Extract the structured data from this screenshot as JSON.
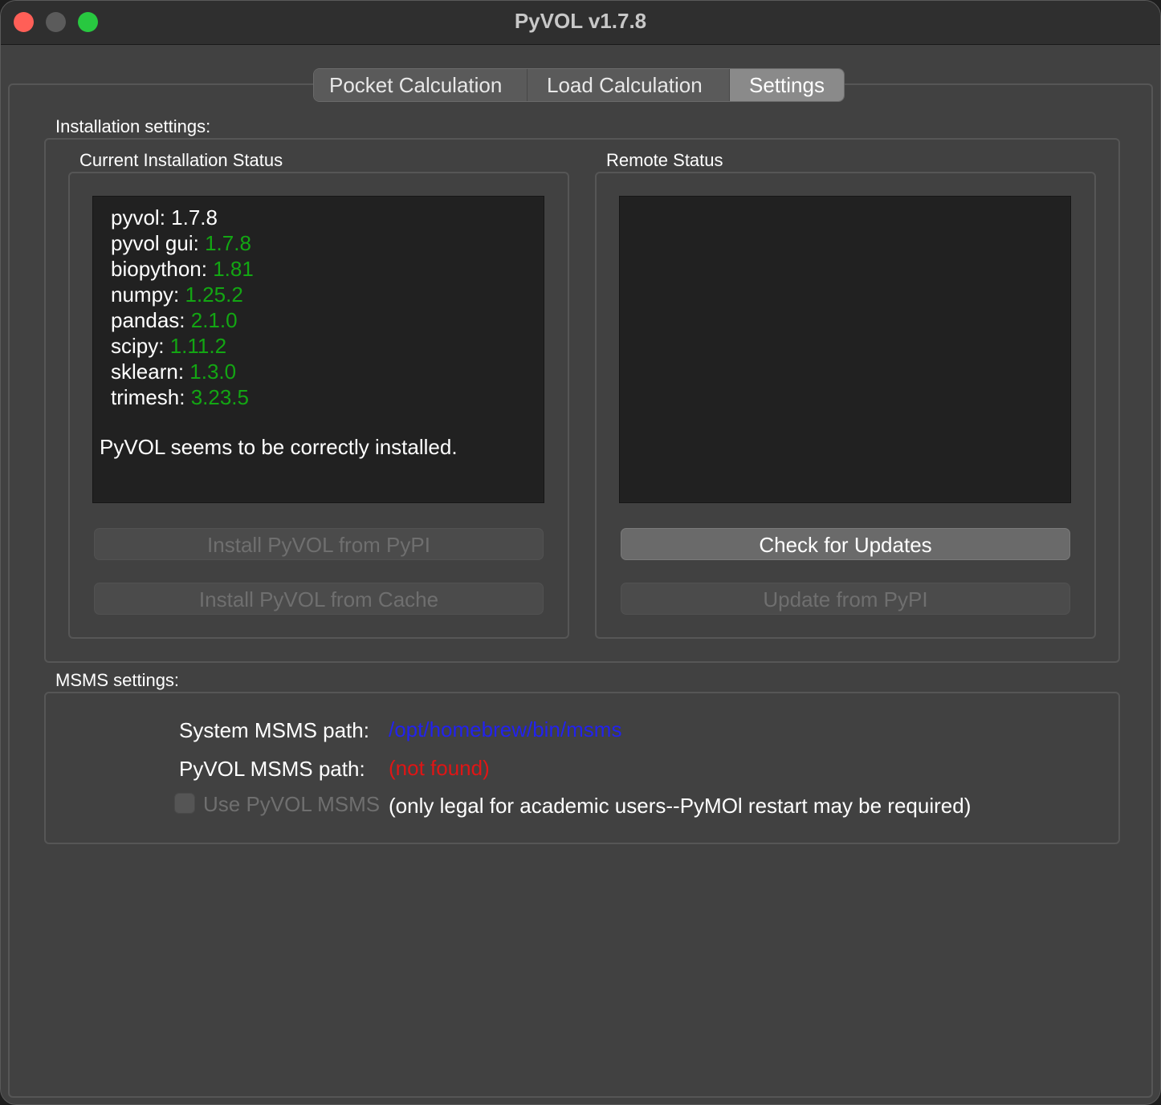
{
  "window": {
    "title": "PyVOL v1.7.8"
  },
  "tabs": [
    {
      "label": "Pocket Calculation"
    },
    {
      "label": "Load Calculation"
    },
    {
      "label": "Settings",
      "selected": true
    }
  ],
  "installation": {
    "section_label": "Installation settings:",
    "current": {
      "label": "Current Installation Status",
      "packages": [
        {
          "name": "pyvol: ",
          "version": "1.7.8"
        },
        {
          "name": "pyvol gui: ",
          "version": "1.7.8"
        },
        {
          "name": "biopython: ",
          "version": "1.81"
        },
        {
          "name": "numpy: ",
          "version": "1.25.2"
        },
        {
          "name": "pandas: ",
          "version": "2.1.0"
        },
        {
          "name": "scipy: ",
          "version": "1.11.2"
        },
        {
          "name": "sklearn: ",
          "version": "1.3.0"
        },
        {
          "name": "trimesh: ",
          "version": "3.23.5"
        }
      ],
      "status_message": "PyVOL seems to be correctly installed.",
      "install_pypi_label": "Install PyVOL from PyPI",
      "install_cache_label": "Install PyVOL from Cache"
    },
    "remote": {
      "label": "Remote Status",
      "check_updates_label": "Check for Updates",
      "update_pypi_label": "Update from PyPI"
    }
  },
  "msms": {
    "section_label": "MSMS settings:",
    "system_path_label": "System MSMS path:",
    "system_path_value": "/opt/homebrew/bin/msms",
    "pyvol_path_label": "PyVOL MSMS path:",
    "pyvol_path_value": "(not found)",
    "use_pyvol_msms_label": "Use PyVOL MSMS",
    "use_pyvol_msms_checked": false,
    "note": "(only legal for academic users--PyMOl restart may be required)"
  },
  "colors": {
    "version_green": "#13a613",
    "path_blue": "#2222ee",
    "path_red": "#e01515"
  }
}
